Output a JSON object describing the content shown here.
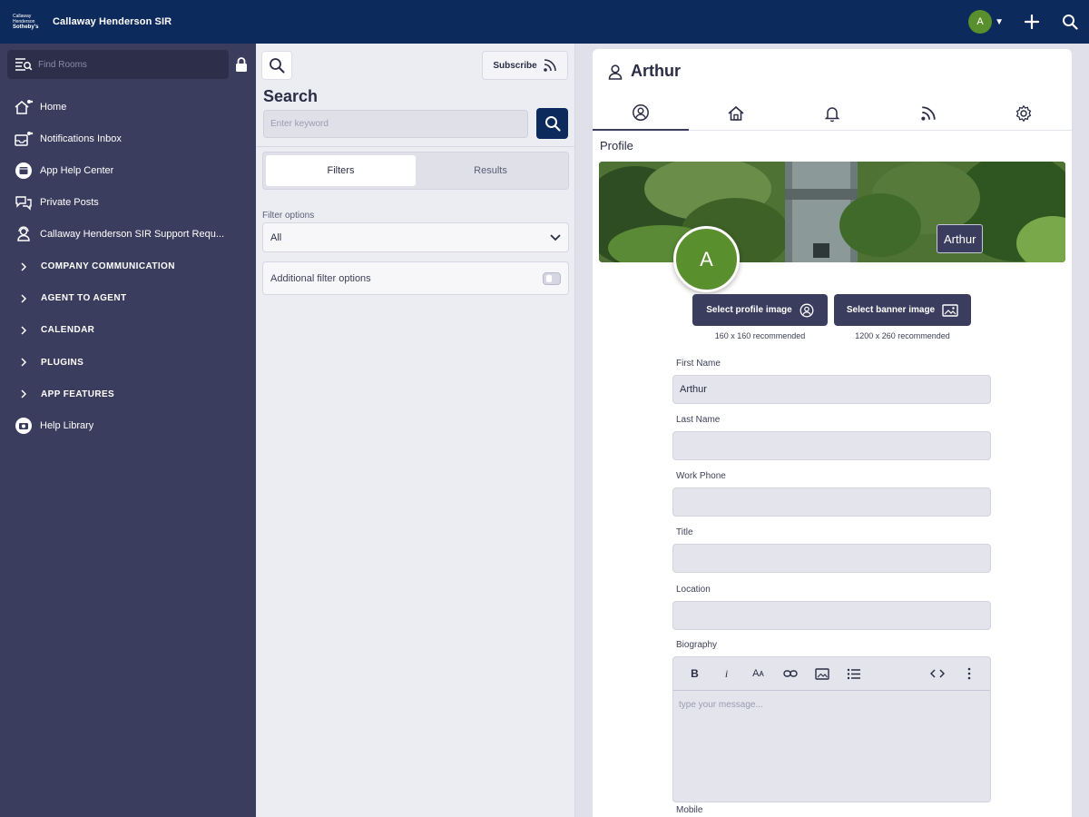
{
  "topbar": {
    "logo_lines": [
      "Callaway",
      "Henderson",
      "Sotheby's"
    ],
    "brand_name": "Callaway Henderson SIR",
    "avatar_initial": "A"
  },
  "sidebar": {
    "find_placeholder": "Find Rooms",
    "items": [
      {
        "label": "Home",
        "icon": "home-icon",
        "type": "link"
      },
      {
        "label": "Notifications Inbox",
        "icon": "inbox-icon",
        "type": "link"
      },
      {
        "label": "App Help Center",
        "icon": "help-circle-icon",
        "type": "link"
      },
      {
        "label": "Private Posts",
        "icon": "chat-bubbles-icon",
        "type": "link"
      },
      {
        "label": "Callaway Henderson SIR Support Requ...",
        "icon": "support-person-icon",
        "type": "link"
      },
      {
        "label": "COMPANY COMMUNICATION",
        "icon": "chevron-right-icon",
        "type": "section"
      },
      {
        "label": "AGENT TO AGENT",
        "icon": "chevron-right-icon",
        "type": "section"
      },
      {
        "label": "CALENDAR",
        "icon": "chevron-right-icon",
        "type": "section"
      },
      {
        "label": "PLUGINS",
        "icon": "chevron-right-icon",
        "type": "section"
      },
      {
        "label": "APP FEATURES",
        "icon": "chevron-right-icon",
        "type": "section"
      },
      {
        "label": "Help Library",
        "icon": "camera-circle-icon",
        "type": "link"
      }
    ]
  },
  "middle": {
    "subscribe_label": "Subscribe",
    "title": "Search",
    "keyword_placeholder": "Enter keyword",
    "tabs": [
      {
        "label": "Filters",
        "active": true
      },
      {
        "label": "Results",
        "active": false
      }
    ],
    "filter_label": "Filter options",
    "filter_value": "All",
    "additional_label": "Additional filter options"
  },
  "profile": {
    "name": "Arthur",
    "section_title": "Profile",
    "banner_tag": "Arthur",
    "avatar_initial": "A",
    "select_profile_label": "Select profile image",
    "select_banner_label": "Select banner image",
    "profile_rec": "160 x 160 recommended",
    "banner_rec": "1200 x 260 recommended",
    "fields": {
      "first_name_label": "First Name",
      "first_name_value": "Arthur",
      "last_name_label": "Last Name",
      "last_name_value": "",
      "work_phone_label": "Work Phone",
      "work_phone_value": "",
      "title_label": "Title",
      "title_value": "",
      "location_label": "Location",
      "location_value": "",
      "biography_label": "Biography",
      "biography_placeholder": "type your message...",
      "mobile_label": "Mobile"
    },
    "editor_tools": {
      "bold": "B",
      "italic": "i",
      "font_size": "Aᴀ"
    }
  },
  "colors": {
    "topbar": "#0d2a5c",
    "sidebar": "#3b3d5e",
    "accent_green": "#5a8f2e"
  }
}
